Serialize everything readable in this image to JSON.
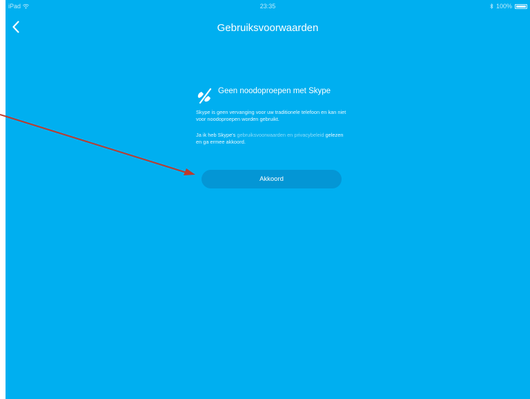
{
  "statusbar": {
    "device": "iPad",
    "time": "23:35",
    "battery": "100%",
    "icons": [
      "wifi-icon",
      "bluetooth-icon",
      "battery-icon"
    ]
  },
  "navbar": {
    "title": "Gebruiksvoorwaarden",
    "back_icon": "chevron-left-icon"
  },
  "notice": {
    "icon": "no-emergency-call-icon",
    "title": "Geen noodoproepen met Skype",
    "description": "Skype is geen vervanging voor uw traditionele telefoon en kan niet voor noodoproepen worden gebruikt.",
    "agree_prefix": "Ja ik heb Skype's ",
    "terms_link": "gebruiksvoorwaarden",
    "and": " en ",
    "privacy_link": "privacybeleid",
    "agree_suffix": " gelezen en ga ermee akkoord."
  },
  "accept_button": {
    "label": "Akkoord"
  },
  "colors": {
    "background": "#00aff0",
    "button": "#0496d5",
    "annotation_arrow": "#c0392b"
  }
}
